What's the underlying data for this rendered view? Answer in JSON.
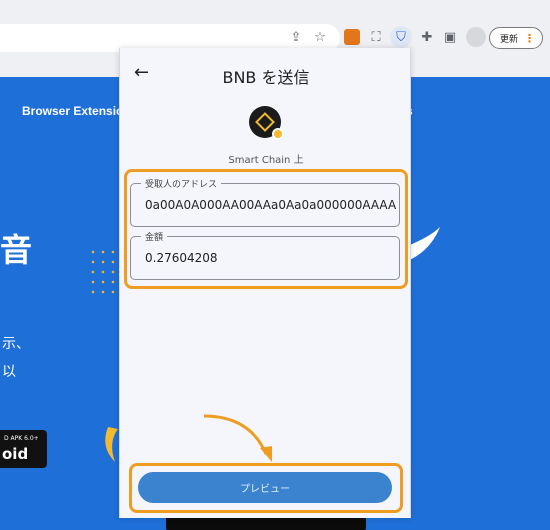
{
  "browser": {
    "update_label": "更新",
    "update_menu": "⋮"
  },
  "website": {
    "nav_item": "Browser Extension",
    "nav_item2": "s",
    "headline_char": "音",
    "side_line1": "示、",
    "side_line2": "以",
    "badge_small": "D APK 6.0+",
    "badge_large": "oid"
  },
  "popup": {
    "back_icon": "arrow-left",
    "title": "BNB を送信",
    "chain_label": "Smart Chain 上",
    "address_field": {
      "label": "受取人のアドレス",
      "value": "0a00A0A000AA00AAa0Aa0a000000AAAA"
    },
    "amount_field": {
      "label": "金額",
      "value": "0.27604208"
    },
    "preview_button": "プレビュー"
  },
  "colors": {
    "site_blue": "#1f6fd8",
    "highlight_orange": "#ee9d22",
    "button_blue": "#3b82cf",
    "bnb_gold": "#f3ba2f"
  }
}
